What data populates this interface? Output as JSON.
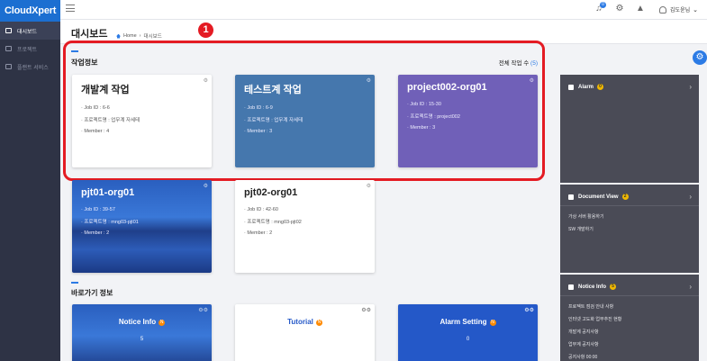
{
  "app": {
    "logo": "CloudXpert"
  },
  "sidebar": {
    "items": [
      {
        "label": "대시보드"
      },
      {
        "label": "프로젝트"
      },
      {
        "label": "플랜트 서비스"
      }
    ]
  },
  "topbar": {
    "bell_badge": "0",
    "user_name": "김도윤님"
  },
  "page": {
    "title": "대시보드",
    "breadcrumb": [
      "Home",
      "대시보드"
    ]
  },
  "callout": "1",
  "work_section": {
    "title": "작업정보",
    "count_label": "전체 작업 수",
    "count_value": "(5)"
  },
  "work_cards": [
    {
      "title": "개발계 작업",
      "job_id": "· Job ID : 6-6",
      "project": "· 프로젝트명 : 업무계 자세테",
      "member": "· Member : 4"
    },
    {
      "title": "테스트계 작업",
      "job_id": "· Job ID : 6-9",
      "project": "· 프로젝트명 : 업무계 자세테",
      "member": "· Member : 3"
    },
    {
      "title": "project002-org01",
      "job_id": "· Job ID : 15-30",
      "project": "· 프로젝트명 : project002",
      "member": "· Member : 3"
    },
    {
      "title": "pjt01-org01",
      "job_id": "· Job ID : 39-57",
      "project": "· 프로젝트명 : mng03-pjt01",
      "member": "· Member : 2"
    },
    {
      "title": "pjt02-org01",
      "job_id": "· Job ID : 42-60",
      "project": "· 프로젝트명 : mng03-pjt02",
      "member": "· Member : 2"
    }
  ],
  "shortcut_section": {
    "title": "바로가기 정보"
  },
  "shortcuts": [
    {
      "title": "Notice Info",
      "badge": "N",
      "value": "5"
    },
    {
      "title": "Tutorial",
      "badge": "N",
      "value": ""
    },
    {
      "title": "Alarm Setting",
      "badge": "N",
      "value": "0"
    }
  ],
  "right_panel": {
    "alarm": {
      "title": "Alarm",
      "badge": "0"
    },
    "document_view": {
      "title": "Document View",
      "badge": "2",
      "items": [
        "가상 서버 활용하기",
        "SW 개발하기"
      ]
    },
    "notice_info": {
      "title": "Notice Info",
      "badge": "5",
      "items": [
        "프로젝트 점검 안내 사항",
        "인터넷 고도화 업무추진 현황",
        "개발계 공지사항",
        "업무계 공지사항",
        "공지사항 00:00"
      ]
    }
  },
  "colors": {
    "accent": "#2c7be5",
    "callout_red": "#e41b23",
    "card_steel_blue": "#4577ad",
    "card_purple": "#7060b8",
    "alarm_setting_blue": "#2458c8"
  }
}
